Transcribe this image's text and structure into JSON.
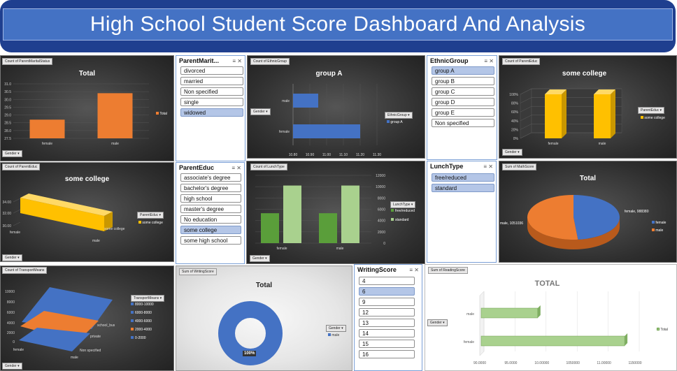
{
  "title": "High School Student Score Dashboard And Analysis",
  "p1": {
    "tag": "Count of ParentMaritalStatus",
    "title": "Total",
    "yticks": [
      "31.0",
      "30.5",
      "30.0",
      "29.5",
      "29.0",
      "28.5",
      "28.0",
      "27.5"
    ],
    "categories": [
      "female",
      "male"
    ],
    "values": [
      28.7,
      30.4
    ],
    "legend": "Total",
    "filter": "Gender",
    "color": "#ed7d31"
  },
  "s1": {
    "title": "ParentMarit...",
    "items": [
      "divorced",
      "married",
      "Non specified",
      "single",
      "widowed"
    ],
    "selected": [
      4
    ]
  },
  "p2": {
    "tag": "Count of EthnicGroup",
    "title": "group A",
    "categories": [
      "male",
      "female"
    ],
    "values": [
      10.95,
      11.2
    ],
    "xticks": [
      "10.80",
      "10.90",
      "11.00",
      "11.10",
      "11.20",
      "11.30"
    ],
    "legend_title": "EthnicGroup",
    "legend": "group A",
    "filter": "Gender",
    "color": "#4472c4"
  },
  "s2": {
    "title": "EthnicGroup",
    "items": [
      "group A",
      "group B",
      "group C",
      "group D",
      "group E",
      "Non specified"
    ],
    "selected": [
      0
    ]
  },
  "p3": {
    "tag": "Count of ParentEduc",
    "title": "some college",
    "yticks": [
      "100%",
      "80%",
      "60%",
      "40%",
      "20%",
      "0%"
    ],
    "categories": [
      "female",
      "male"
    ],
    "values": [
      1.0,
      1.0
    ],
    "legend_title": "ParentEduc",
    "legend": "some college",
    "filter": "Gender",
    "color": "#ffc000"
  },
  "p4": {
    "tag": "Count of ParentEduc",
    "title": "some college",
    "yticks": [
      "34.00",
      "32.00",
      "30.00"
    ],
    "categories": [
      "female",
      "male"
    ],
    "series_label": "some college",
    "legend_title": "ParentEduc",
    "legend": "some college",
    "filter": "Gender",
    "color": "#ffc000"
  },
  "s3": {
    "title": "ParentEduc",
    "items": [
      "associate's degree",
      "bachelor's degree",
      "high school",
      "master's degree",
      "No education",
      "some college",
      "some high school"
    ],
    "selected": [
      5
    ]
  },
  "p5": {
    "tag": "Count of LunchType",
    "yticks": [
      "12000",
      "10000",
      "8000",
      "6000",
      "4000",
      "2000",
      "0"
    ],
    "categories": [
      "female",
      "male"
    ],
    "series": [
      {
        "name": "free/reduced",
        "values": [
          5300,
          5300
        ],
        "color": "#5a9e3a"
      },
      {
        "name": "standard",
        "values": [
          10200,
          10200
        ],
        "color": "#a9d18e"
      }
    ],
    "legend_title": "LunchType",
    "filter": "Gender"
  },
  "s4": {
    "title": "LunchType",
    "items": [
      "free/reduced",
      "standard"
    ],
    "selected": [
      0,
      1
    ]
  },
  "p6": {
    "tag": "Sum of MathScore",
    "title": "Total",
    "slices": [
      {
        "name": "female",
        "value": 988380,
        "label": "female, 988380",
        "color": "#4472c4"
      },
      {
        "name": "male",
        "value": 1051036,
        "label": "male, 1051036",
        "color": "#ed7d31"
      }
    ]
  },
  "p7": {
    "tag": "Count of TransportMeans",
    "yticks": [
      "10000",
      "8000",
      "6000",
      "4000",
      "2000",
      "0"
    ],
    "categories": [
      "female",
      "male"
    ],
    "depth_labels": [
      "school_bus",
      "private",
      "Non specified"
    ],
    "legend_title": "TransportMeans",
    "legend": [
      {
        "name": "8000-10000",
        "color": "#4472c4"
      },
      {
        "name": "6000-8000",
        "color": "#4472c4"
      },
      {
        "name": "4000-6000",
        "color": "#4472c4"
      },
      {
        "name": "2000-4000",
        "color": "#ed7d31"
      },
      {
        "name": "0-2000",
        "color": "#4472c4"
      }
    ],
    "filter": "Gender"
  },
  "p8": {
    "tag": "Sum of WritingScore",
    "title": "Total",
    "value_label": "100%",
    "legend_title": "Gender",
    "legend": "male",
    "color": "#4472c4"
  },
  "s5": {
    "title": "WritingScore",
    "items": [
      "4",
      "6",
      "9",
      "12",
      "13",
      "14",
      "15",
      "16"
    ],
    "selected": [
      1
    ]
  },
  "p9": {
    "tag": "Sum of ReadingScore",
    "title": "TOTAL",
    "categories": [
      "male",
      "female"
    ],
    "values": [
      1000,
      1140
    ],
    "xticks": [
      "90.0000",
      "95.0000",
      "10.00000",
      "1050000",
      "11.00000",
      "1150000"
    ],
    "legend": "Total",
    "filter": "Gender",
    "color": "#a9d18e"
  }
}
